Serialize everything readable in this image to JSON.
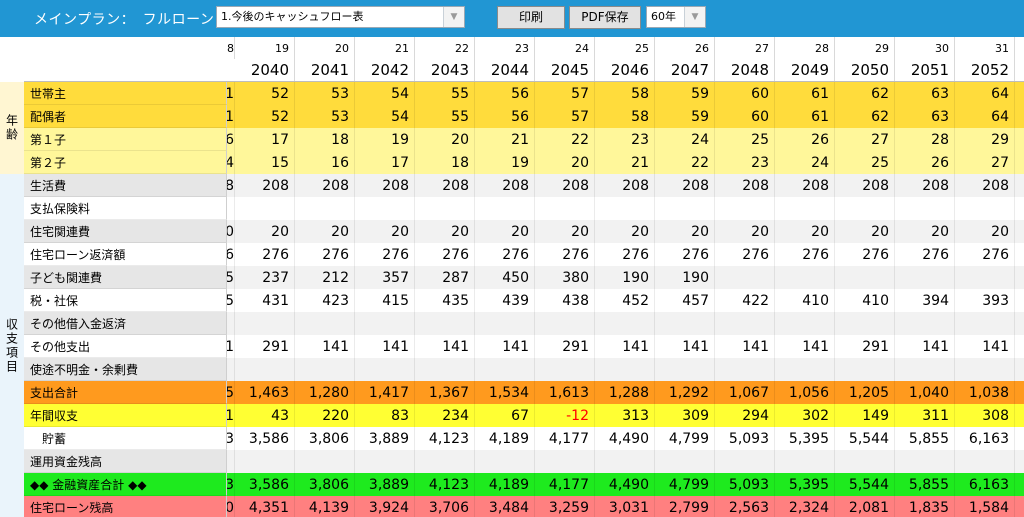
{
  "toolbar": {
    "plan_title": "メインプラン：　フルローン",
    "report_select": "1.今後のキャッシュフロー表",
    "print_label": "印刷",
    "pdf_label": "PDF保存",
    "period_select": "60年",
    "dropdown_arrow": "▼"
  },
  "side_labels": {
    "age": "年齢",
    "income_expense": "収支項目"
  },
  "columns": {
    "edge_index": "8",
    "indices": [
      "19",
      "20",
      "21",
      "22",
      "23",
      "24",
      "25",
      "26",
      "27",
      "28",
      "29",
      "30",
      "31"
    ],
    "years": [
      "2040",
      "2041",
      "2042",
      "2043",
      "2044",
      "2045",
      "2046",
      "2047",
      "2048",
      "2049",
      "2050",
      "2051",
      "2052"
    ]
  },
  "rows": [
    {
      "label": "世帯主",
      "edge": "1",
      "values": [
        "52",
        "53",
        "54",
        "55",
        "56",
        "57",
        "58",
        "59",
        "60",
        "61",
        "62",
        "63",
        "64"
      ],
      "bg": "#ffdc3c",
      "labelbg": "#ffdc3c"
    },
    {
      "label": "配偶者",
      "edge": "1",
      "values": [
        "52",
        "53",
        "54",
        "55",
        "56",
        "57",
        "58",
        "59",
        "60",
        "61",
        "62",
        "63",
        "64"
      ],
      "bg": "#ffdc3c",
      "labelbg": "#ffdc3c"
    },
    {
      "label": "第１子",
      "edge": "6",
      "values": [
        "17",
        "18",
        "19",
        "20",
        "21",
        "22",
        "23",
        "24",
        "25",
        "26",
        "27",
        "28",
        "29"
      ],
      "bg": "#fff79a",
      "labelbg": "#fff79a"
    },
    {
      "label": "第２子",
      "edge": "4",
      "values": [
        "15",
        "16",
        "17",
        "18",
        "19",
        "20",
        "21",
        "22",
        "23",
        "24",
        "25",
        "26",
        "27"
      ],
      "bg": "#fff79a",
      "labelbg": "#fff79a"
    },
    {
      "label": "生活費",
      "edge": "8",
      "values": [
        "208",
        "208",
        "208",
        "208",
        "208",
        "208",
        "208",
        "208",
        "208",
        "208",
        "208",
        "208",
        "208"
      ],
      "bg": "#f2f2f2",
      "labelbg": "#e6e6e6"
    },
    {
      "label": "支払保険料",
      "edge": "",
      "values": [
        "",
        "",
        "",
        "",
        "",
        "",
        "",
        "",
        "",
        "",
        "",
        "",
        ""
      ],
      "bg": "#ffffff",
      "labelbg": "#ffffff"
    },
    {
      "label": "住宅関連費",
      "edge": "0",
      "values": [
        "20",
        "20",
        "20",
        "20",
        "20",
        "20",
        "20",
        "20",
        "20",
        "20",
        "20",
        "20",
        "20"
      ],
      "bg": "#f2f2f2",
      "labelbg": "#e6e6e6"
    },
    {
      "label": "住宅ローン返済額",
      "edge": "6",
      "values": [
        "276",
        "276",
        "276",
        "276",
        "276",
        "276",
        "276",
        "276",
        "276",
        "276",
        "276",
        "276",
        "276"
      ],
      "bg": "#ffffff",
      "labelbg": "#ffffff"
    },
    {
      "label": "子ども関連費",
      "edge": "5",
      "values": [
        "237",
        "212",
        "357",
        "287",
        "450",
        "380",
        "190",
        "190",
        "",
        "",
        "",
        "",
        ""
      ],
      "bg": "#f2f2f2",
      "labelbg": "#e6e6e6"
    },
    {
      "label": "税・社保",
      "edge": "5",
      "values": [
        "431",
        "423",
        "415",
        "435",
        "439",
        "438",
        "452",
        "457",
        "422",
        "410",
        "410",
        "394",
        "393"
      ],
      "bg": "#ffffff",
      "labelbg": "#ffffff"
    },
    {
      "label": "その他借入金返済",
      "edge": "",
      "values": [
        "",
        "",
        "",
        "",
        "",
        "",
        "",
        "",
        "",
        "",
        "",
        "",
        ""
      ],
      "bg": "#f2f2f2",
      "labelbg": "#e6e6e6"
    },
    {
      "label": "その他支出",
      "edge": "1",
      "values": [
        "291",
        "141",
        "141",
        "141",
        "141",
        "291",
        "141",
        "141",
        "141",
        "141",
        "291",
        "141",
        "141"
      ],
      "bg": "#ffffff",
      "labelbg": "#ffffff"
    },
    {
      "label": "使途不明金・余剰費",
      "edge": "",
      "values": [
        "",
        "",
        "",
        "",
        "",
        "",
        "",
        "",
        "",
        "",
        "",
        "",
        ""
      ],
      "bg": "#f2f2f2",
      "labelbg": "#e6e6e6"
    },
    {
      "label": "支出合計",
      "edge": "5",
      "values": [
        "1,463",
        "1,280",
        "1,417",
        "1,367",
        "1,534",
        "1,613",
        "1,288",
        "1,292",
        "1,067",
        "1,056",
        "1,205",
        "1,040",
        "1,038"
      ],
      "bg": "#ff9a1e",
      "labelbg": "#ff9a1e"
    },
    {
      "label": "年間収支",
      "edge": "1",
      "values": [
        "43",
        "220",
        "83",
        "234",
        "67",
        "-12",
        "313",
        "309",
        "294",
        "302",
        "149",
        "311",
        "308"
      ],
      "bg": "#ffff33",
      "labelbg": "#ffff33"
    },
    {
      "label": "貯蓄",
      "edge": "3",
      "values": [
        "3,586",
        "3,806",
        "3,889",
        "4,123",
        "4,189",
        "4,177",
        "4,490",
        "4,799",
        "5,093",
        "5,395",
        "5,544",
        "5,855",
        "6,163"
      ],
      "bg": "#ffffff",
      "labelbg": "#ffffff",
      "indent": true
    },
    {
      "label": "運用資金残高",
      "edge": "",
      "values": [
        "",
        "",
        "",
        "",
        "",
        "",
        "",
        "",
        "",
        "",
        "",
        "",
        ""
      ],
      "bg": "#f2f2f2",
      "labelbg": "#e6e6e6"
    },
    {
      "label": "◆◆ 金融資産合計 ◆◆",
      "edge": "3",
      "values": [
        "3,586",
        "3,806",
        "3,889",
        "4,123",
        "4,189",
        "4,177",
        "4,490",
        "4,799",
        "5,093",
        "5,395",
        "5,544",
        "5,855",
        "6,163"
      ],
      "bg": "#1eea1e",
      "labelbg": "#1eea1e"
    },
    {
      "label": "住宅ローン残高",
      "edge": "0",
      "values": [
        "4,351",
        "4,139",
        "3,924",
        "3,706",
        "3,484",
        "3,259",
        "3,031",
        "2,799",
        "2,563",
        "2,324",
        "2,081",
        "1,835",
        "1,584"
      ],
      "bg": "#ff8080",
      "labelbg": "#ff8080"
    }
  ]
}
